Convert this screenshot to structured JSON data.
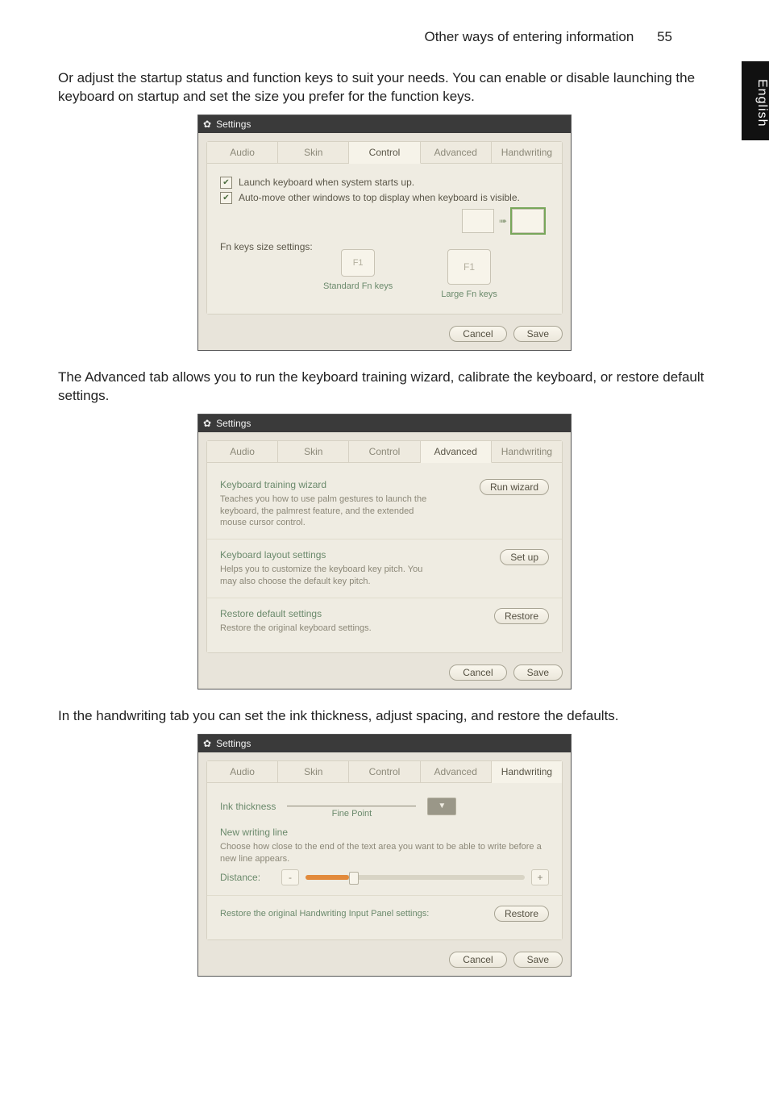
{
  "header": {
    "title": "Other ways of entering information",
    "page": "55"
  },
  "lang_tab": "English",
  "para1": "Or adjust the startup status and function keys to suit your needs. You can enable or disable launching the keyboard on startup and set the size you prefer for the function keys.",
  "para2": "The Advanced tab allows you to run the keyboard training wizard, calibrate the keyboard, or restore default settings.",
  "para3": "In the handwriting tab you can set the ink thickness, adjust spacing, and restore the defaults.",
  "dialog": {
    "title": "Settings",
    "tabs": [
      "Audio",
      "Skin",
      "Control",
      "Advanced",
      "Handwriting"
    ],
    "buttons": {
      "cancel": "Cancel",
      "save": "Save"
    }
  },
  "control_tab": {
    "chk1": "Launch keyboard when system starts up.",
    "chk2": "Auto-move other windows to top display when keyboard is visible.",
    "fn_label": "Fn keys size settings:",
    "key_text": "F1",
    "std_caption": "Standard Fn keys",
    "large_caption": "Large Fn keys"
  },
  "advanced_tab": {
    "s1_title": "Keyboard training wizard",
    "s1_desc": "Teaches you how to use palm gestures to launch the keyboard, the palmrest feature, and the extended mouse cursor control.",
    "s1_btn": "Run wizard",
    "s2_title": "Keyboard layout settings",
    "s2_desc": "Helps you to customize the keyboard key pitch. You may also choose the default key pitch.",
    "s2_btn": "Set up",
    "s3_title": "Restore default settings",
    "s3_desc": "Restore the original keyboard settings.",
    "s3_btn": "Restore"
  },
  "handwriting_tab": {
    "ink_label": "Ink thickness",
    "ink_caption": "Fine Point",
    "newline_title": "New writing line",
    "newline_desc": "Choose how close to the end of the text area you want to be able to write before a new line appears.",
    "distance_label": "Distance:",
    "minus": "-",
    "plus": "+",
    "restore_label": "Restore the original Handwriting Input Panel settings:",
    "restore_btn": "Restore"
  }
}
